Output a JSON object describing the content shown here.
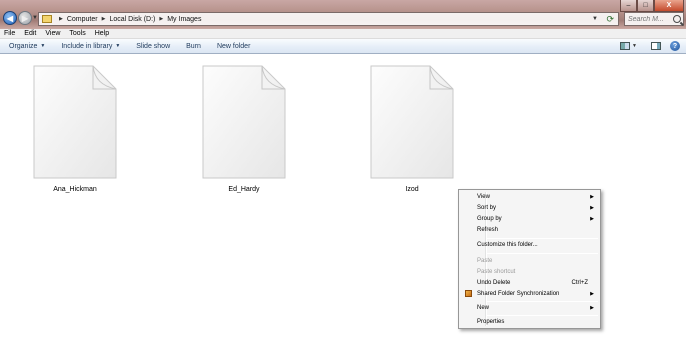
{
  "addressbar": {
    "crumbs": [
      "Computer",
      "Local Disk (D:)",
      "My Images"
    ]
  },
  "search": {
    "placeholder": "Search M..."
  },
  "window_controls": {
    "minimize": "–",
    "maximize": "□",
    "close": "X"
  },
  "menubar": {
    "items": [
      "File",
      "Edit",
      "View",
      "Tools",
      "Help"
    ]
  },
  "commandbar": {
    "organize": "Organize",
    "include_in_library": "Include in library",
    "slide_show": "Slide show",
    "burn": "Burn",
    "new_folder": "New folder",
    "help": "?"
  },
  "files": [
    {
      "name": "Ana_Hickman"
    },
    {
      "name": "Ed_Hardy"
    },
    {
      "name": "Izod"
    }
  ],
  "context_menu": {
    "view": "View",
    "sort_by": "Sort by",
    "group_by": "Group by",
    "refresh": "Refresh",
    "customize": "Customize this folder...",
    "paste": "Paste",
    "paste_shortcut": "Paste shortcut",
    "undo_delete": "Undo Delete",
    "undo_delete_shortcut": "Ctrl+Z",
    "shared_folder_sync": "Shared Folder Synchronization",
    "new": "New",
    "properties": "Properties",
    "submenu_arrow": "▶"
  }
}
